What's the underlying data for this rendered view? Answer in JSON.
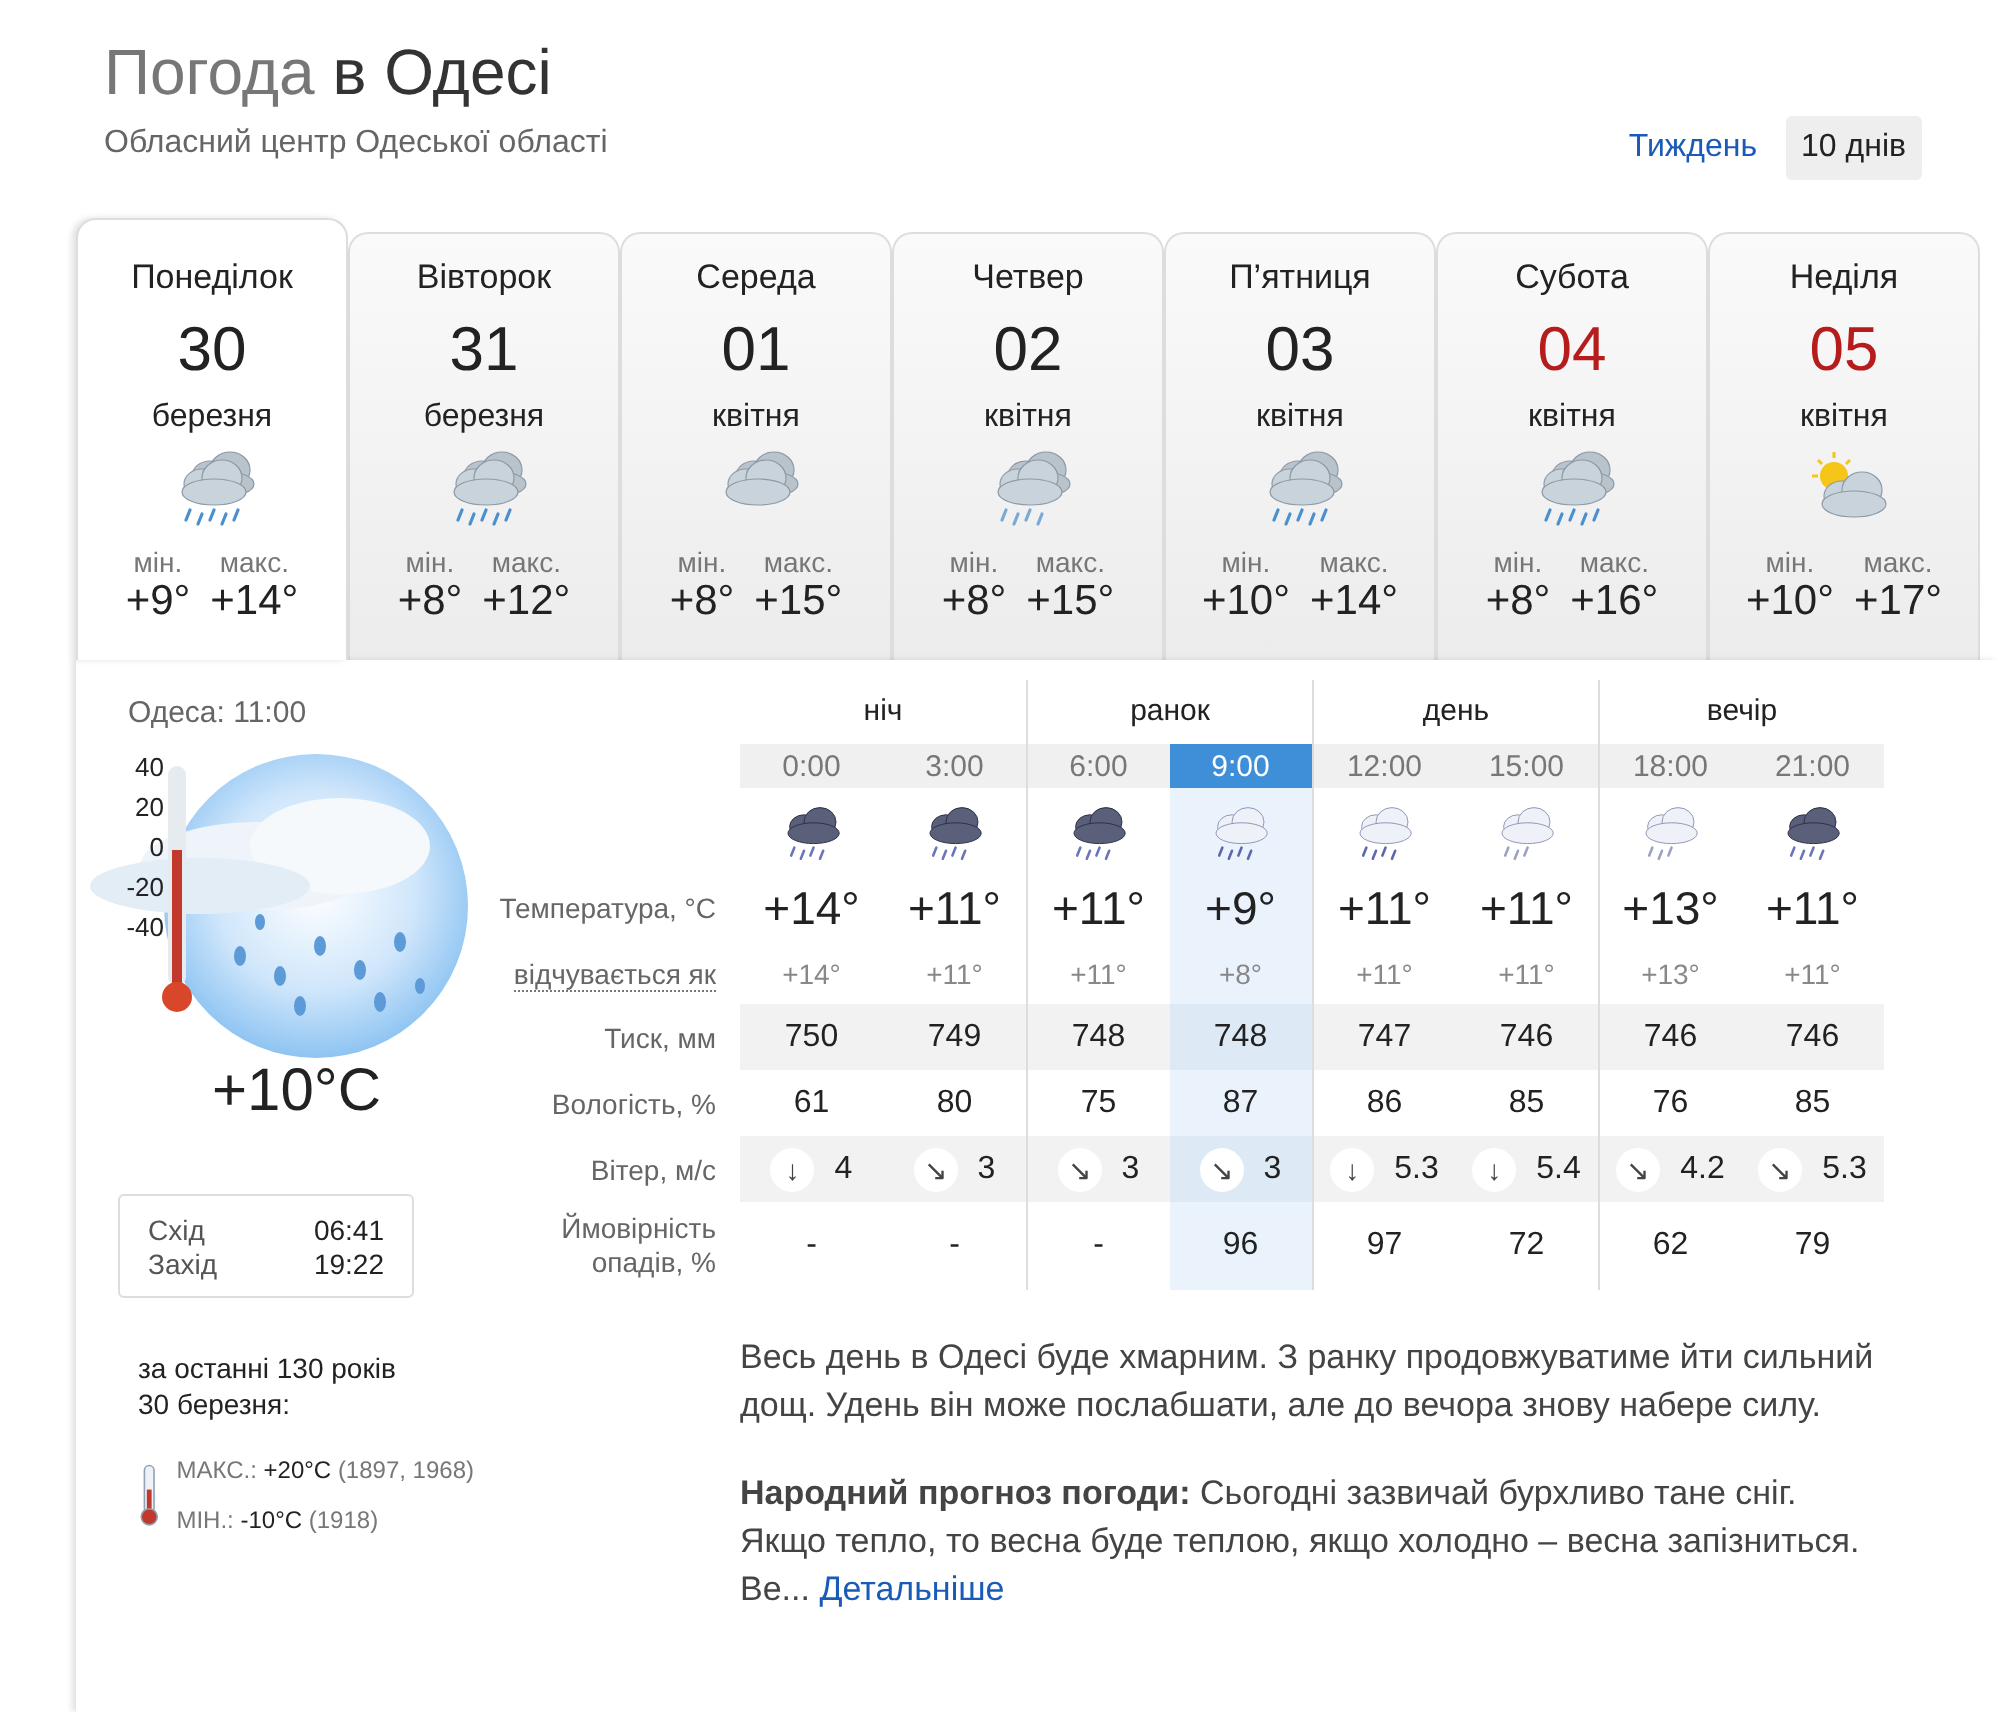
{
  "header": {
    "title_lead": "Погода",
    "title_city": "в Одесі",
    "subtitle": "Обласний центр Одеської області"
  },
  "period_tabs": [
    {
      "label": "Тиждень",
      "selected": false
    },
    {
      "label": "10 днів",
      "selected": true
    }
  ],
  "days": [
    {
      "weekday": "Понеділок",
      "date": "30",
      "month": "березня",
      "weekend": false,
      "kind": "heavy-rain",
      "min_label": "мін.",
      "min": "+9°",
      "max_label": "макс.",
      "max": "+14°",
      "selected": true
    },
    {
      "weekday": "Вівторок",
      "date": "31",
      "month": "березня",
      "weekend": false,
      "kind": "heavy-rain",
      "min_label": "мін.",
      "min": "+8°",
      "max_label": "макс.",
      "max": "+12°",
      "selected": false
    },
    {
      "weekday": "Середа",
      "date": "01",
      "month": "квітня",
      "weekend": false,
      "kind": "cloudy",
      "min_label": "мін.",
      "min": "+8°",
      "max_label": "макс.",
      "max": "+15°",
      "selected": false
    },
    {
      "weekday": "Четвер",
      "date": "02",
      "month": "квітня",
      "weekend": false,
      "kind": "rain",
      "min_label": "мін.",
      "min": "+8°",
      "max_label": "макс.",
      "max": "+15°",
      "selected": false
    },
    {
      "weekday": "П’ятниця",
      "date": "03",
      "month": "квітня",
      "weekend": false,
      "kind": "heavy-rain",
      "min_label": "мін.",
      "min": "+10°",
      "max_label": "макс.",
      "max": "+14°",
      "selected": false
    },
    {
      "weekday": "Субота",
      "date": "04",
      "month": "квітня",
      "weekend": true,
      "kind": "heavy-rain",
      "min_label": "мін.",
      "min": "+8°",
      "max_label": "макс.",
      "max": "+16°",
      "selected": false
    },
    {
      "weekday": "Неділя",
      "date": "05",
      "month": "квітня",
      "weekend": true,
      "kind": "sun-cloud",
      "min_label": "мін.",
      "min": "+10°",
      "max_label": "макс.",
      "max": "+17°",
      "selected": false
    }
  ],
  "current": {
    "place_time": "Одеса: 11:00",
    "scale": [
      "40",
      "20",
      "0",
      "-20",
      "-40"
    ],
    "thermometer": {
      "level": 0.62
    },
    "temperature": "+10°C",
    "sunrise_label": "Схід",
    "sunrise": "06:41",
    "sunset_label": "Захід",
    "sunset": "19:22",
    "history_title": "за останні 130 років",
    "history_date": "30 березня:",
    "history_max_label": "МАКС.:",
    "history_max": "+20°C",
    "history_max_years": "(1897, 1968)",
    "history_min_label": "МІН.:",
    "history_min": "-10°C",
    "history_min_years": "(1918)"
  },
  "row_labels": {
    "temperature": "Температура, °C",
    "feels": "відчувається як",
    "pressure": "Тиск, мм",
    "humidity": "Вологість, %",
    "wind": "Вітер, м/с",
    "precip": "Ймовірність опадів, %"
  },
  "periods": [
    {
      "name": "ніч",
      "hours": [
        {
          "time": "0:00",
          "selected": false,
          "kind": "storm",
          "temp": "+14°",
          "feels": "+14°",
          "pressure": "750",
          "humidity": "61",
          "wind_arrow": "↓",
          "wind": "4",
          "precip": "-"
        },
        {
          "time": "3:00",
          "selected": false,
          "kind": "storm",
          "temp": "+11°",
          "feels": "+11°",
          "pressure": "749",
          "humidity": "80",
          "wind_arrow": "↘",
          "wind": "3",
          "precip": "-"
        }
      ]
    },
    {
      "name": "ранок",
      "hours": [
        {
          "time": "6:00",
          "selected": false,
          "kind": "storm",
          "temp": "+11°",
          "feels": "+11°",
          "pressure": "748",
          "humidity": "75",
          "wind_arrow": "↘",
          "wind": "3",
          "precip": "-"
        },
        {
          "time": "9:00",
          "selected": true,
          "kind": "shower",
          "temp": "+9°",
          "feels": "+8°",
          "pressure": "748",
          "humidity": "87",
          "wind_arrow": "↘",
          "wind": "3",
          "precip": "96"
        }
      ]
    },
    {
      "name": "день",
      "hours": [
        {
          "time": "12:00",
          "selected": false,
          "kind": "shower",
          "temp": "+11°",
          "feels": "+11°",
          "pressure": "747",
          "humidity": "86",
          "wind_arrow": "↓",
          "wind": "5.3",
          "precip": "97"
        },
        {
          "time": "15:00",
          "selected": false,
          "kind": "drizzle",
          "temp": "+11°",
          "feels": "+11°",
          "pressure": "746",
          "humidity": "85",
          "wind_arrow": "↓",
          "wind": "5.4",
          "precip": "72"
        }
      ]
    },
    {
      "name": "вечір",
      "hours": [
        {
          "time": "18:00",
          "selected": false,
          "kind": "drizzle",
          "temp": "+13°",
          "feels": "+13°",
          "pressure": "746",
          "humidity": "76",
          "wind_arrow": "↘",
          "wind": "4.2",
          "precip": "62"
        },
        {
          "time": "21:00",
          "selected": false,
          "kind": "storm",
          "temp": "+11°",
          "feels": "+11°",
          "pressure": "746",
          "humidity": "85",
          "wind_arrow": "↘",
          "wind": "5.3",
          "precip": "79"
        }
      ]
    }
  ],
  "description": "Весь день в Одесі буде хмарним. З ранку продовжуватиме йти сильний дощ. Удень він може послабшати, але до вечора знову набере силу.",
  "folk": {
    "text": "**Народний прогноз погоди:** Сьогодні зазвичай бурхливо тане сніг. Якщо тепло, то весна буде теплою, якщо холодно – весна запізниться. Ве...",
    "link": "Детальніше"
  }
}
